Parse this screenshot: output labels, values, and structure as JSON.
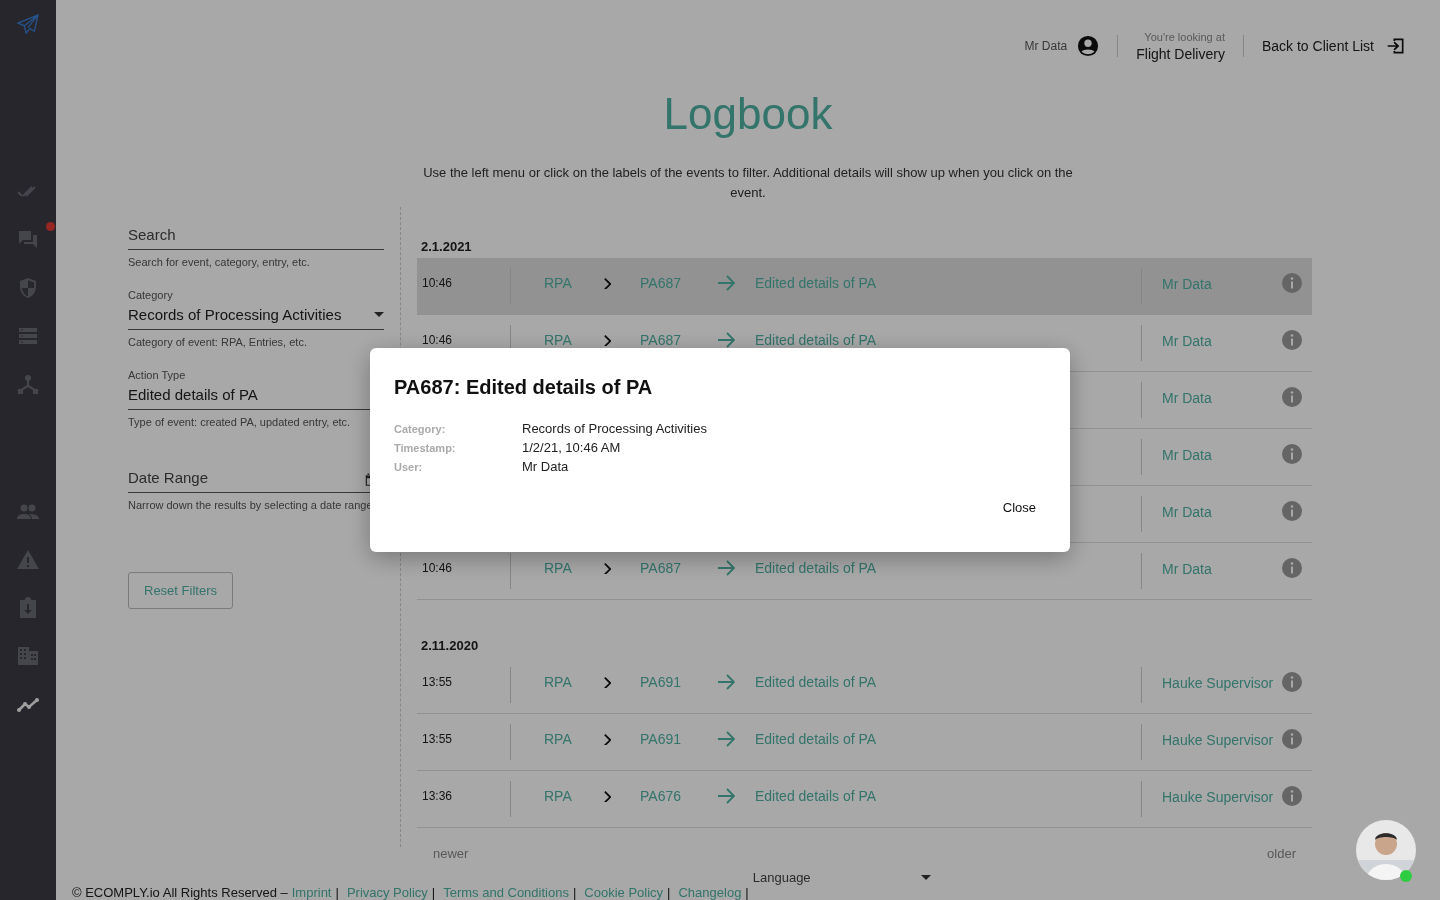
{
  "sidebar": {
    "items": [
      {
        "kind": "checks",
        "selected": false,
        "badge": false
      },
      {
        "kind": "chat",
        "selected": false,
        "badge": true
      },
      {
        "kind": "shield",
        "selected": false,
        "badge": false
      },
      {
        "kind": "list",
        "selected": false,
        "badge": false
      },
      {
        "kind": "hub",
        "selected": false,
        "badge": false
      },
      {
        "kind": "people",
        "selected": false,
        "badge": false
      },
      {
        "kind": "warning",
        "selected": false,
        "badge": false
      },
      {
        "kind": "clipboard",
        "selected": false,
        "badge": false
      },
      {
        "kind": "building",
        "selected": false,
        "badge": false
      },
      {
        "kind": "trend",
        "selected": true,
        "badge": false
      }
    ]
  },
  "header": {
    "user": "Mr Data",
    "context_label": "You're looking at",
    "context": "Flight Delivery",
    "back": "Back to Client List"
  },
  "title": "Logbook",
  "description": "Use the left menu or click on the labels of the events to filter. Additional details will show up when you click on the event.",
  "filters": {
    "search": {
      "placeholder": "Search",
      "hint": "Search for event, category, entry, etc."
    },
    "category": {
      "label": "Category",
      "value": "Records of Processing Activities",
      "hint": "Category of event: RPA, Entries, etc."
    },
    "action_type": {
      "label": "Action Type",
      "value": "Edited details of PA",
      "hint": "Type of event: created PA, updated entry, etc."
    },
    "date_range": {
      "placeholder": "Date Range",
      "hint": "Narrow down the results by selecting a date range"
    },
    "reset": "Reset Filters"
  },
  "log": {
    "groups": [
      {
        "date": "2.1.2021",
        "rows": [
          {
            "time": "10:46",
            "category": "RPA",
            "entry": "PA687",
            "action": "Edited details of PA",
            "user": "Mr Data",
            "selected": true
          },
          {
            "time": "10:46",
            "category": "RPA",
            "entry": "PA687",
            "action": "Edited details of PA",
            "user": "Mr Data",
            "selected": false
          },
          {
            "user": "Mr Data",
            "selected": false
          },
          {
            "user": "Mr Data",
            "selected": false
          },
          {
            "user": "Mr Data",
            "selected": false
          },
          {
            "time": "10:46",
            "category": "RPA",
            "entry": "PA687",
            "action": "Edited details of PA",
            "user": "Mr Data",
            "selected": false
          }
        ]
      },
      {
        "date": "2.11.2020",
        "rows": [
          {
            "time": "13:55",
            "category": "RPA",
            "entry": "PA691",
            "action": "Edited details of PA",
            "user": "Hauke Supervisor",
            "selected": false
          },
          {
            "time": "13:55",
            "category": "RPA",
            "entry": "PA691",
            "action": "Edited details of PA",
            "user": "Hauke Supervisor",
            "selected": false
          },
          {
            "time": "13:36",
            "category": "RPA",
            "entry": "PA676",
            "action": "Edited details of PA",
            "user": "Hauke Supervisor",
            "selected": false
          }
        ]
      }
    ],
    "newer": "newer",
    "older": "older"
  },
  "modal": {
    "title": "PA687: Edited details of PA",
    "fields": [
      {
        "label": "Category:",
        "value": "Records of Processing Activities"
      },
      {
        "label": "Timestamp:",
        "value": "1/2/21, 10:46 AM"
      },
      {
        "label": "User:",
        "value": "Mr Data"
      }
    ],
    "close": "Close"
  },
  "footer": {
    "copyright": "© ECOMPLY.io All Rights Reserved –",
    "links": [
      "Imprint",
      "Privacy Policy",
      "Terms and Conditions",
      "Cookie Policy",
      "Changelog"
    ],
    "separator": "|",
    "language": {
      "placeholder": "Language"
    }
  },
  "chat": {
    "online": true
  }
}
